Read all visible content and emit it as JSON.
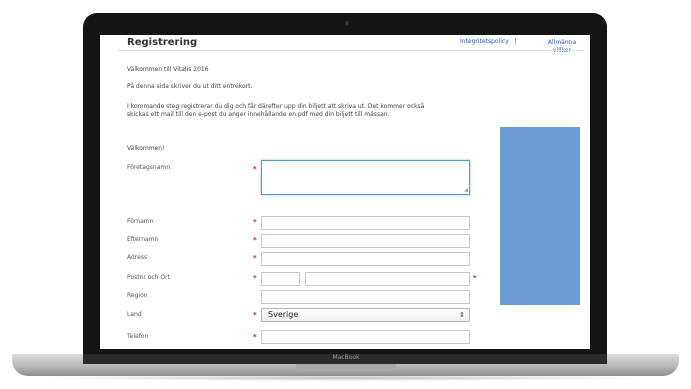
{
  "laptop": {
    "brand": "MacBook"
  },
  "page": {
    "title": "Registrering",
    "links": {
      "privacy": "Integritetspolicy",
      "separator": "|",
      "terms": "Allmänna villkor"
    },
    "welcome": "Välkommen till Vitalis 2016",
    "intro": "På denna sida skriver du ut ditt entrékort.",
    "info_line1": "I kommande steg registrerar du dig och får därefter upp din biljett att skriva ut. Det kommer också",
    "info_line2": "skickas ett mail till den e-post du anger innehållande en pdf med din biljett till mässan.",
    "greeting": "Välkommen!"
  },
  "form": {
    "company_label": "Företagsnamn",
    "firstname_label": "Förnamn",
    "lastname_label": "Efternamn",
    "address_label": "Adress",
    "zip_city_label": "Postnr och Ort",
    "region_label": "Region",
    "country_label": "Land",
    "country_value": "Sverige",
    "phone_label": "Telefon",
    "required_mark": "*"
  },
  "colors": {
    "sidebar": "#6b9bd3",
    "link": "#2a57b8",
    "required": "#c81a1a",
    "focus": "#4a9fd8"
  }
}
